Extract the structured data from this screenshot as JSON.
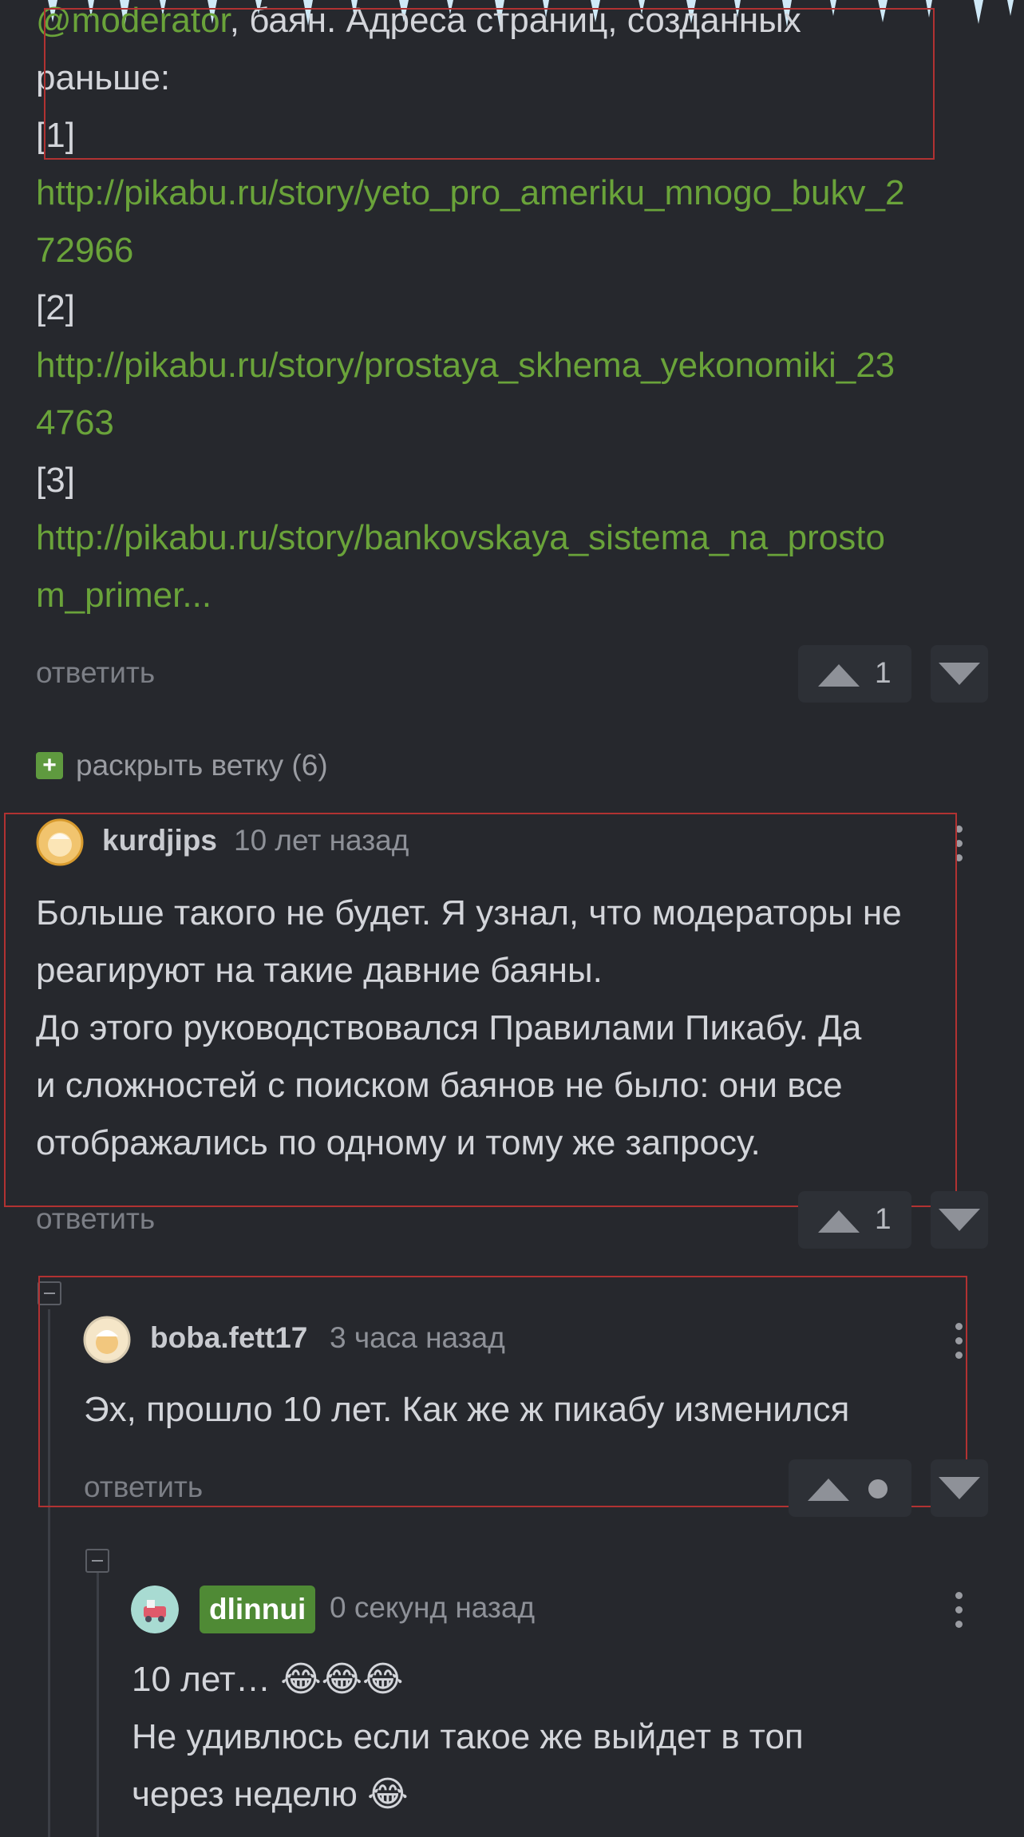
{
  "comment1": {
    "mention": "@moderator",
    "line1_rest": ", баян. Адреса страниц, созданных",
    "line2": "раньше:",
    "ref1_label": "[1]",
    "ref1_url_a": "http://pikabu.ru/story/yeto_pro_ameriku_mnogo_bukv_2",
    "ref1_url_b": "72966",
    "ref2_label": "[2]",
    "ref2_url_a": "http://pikabu.ru/story/prostaya_skhema_yekonomiki_23",
    "ref2_url_b": "4763",
    "ref3_label": "[3]",
    "ref3_url_a": "http://pikabu.ru/story/bankovskaya_sistema_na_prosto",
    "ref3_url_b": "m_primer...",
    "reply_label": "ответить",
    "rating": "1"
  },
  "expand_branch": {
    "icon": "+",
    "label": "раскрыть ветку (6)"
  },
  "comment2": {
    "user": "kurdjips",
    "time": "10 лет назад",
    "lines": [
      "Больше такого не будет. Я узнал, что модераторы не",
      "реагируют на такие давние баяны.",
      "До этого руководствовался Правилами Пикабу. Да",
      "и сложностей с поиском баянов не было: они все",
      "отображались по одному и тому же запросу."
    ],
    "reply_label": "ответить",
    "rating": "1"
  },
  "comment3": {
    "user": "boba.fett17",
    "time": "3 часа назад",
    "text": "Эх, прошло 10 лет. Как же ж пикабу изменился",
    "reply_label": "ответить"
  },
  "comment4": {
    "user": "dlinnui",
    "time": "0 секунд назад",
    "line1": "10 лет… 😂😂😂",
    "line2": "Не удивлюсь если такое же выйдет в топ",
    "line3": "через неделю 😂"
  },
  "colors": {
    "background": "#26282d",
    "link": "#6aa33a",
    "badge": "#4f8a35",
    "highlight_box": "#b13232"
  }
}
